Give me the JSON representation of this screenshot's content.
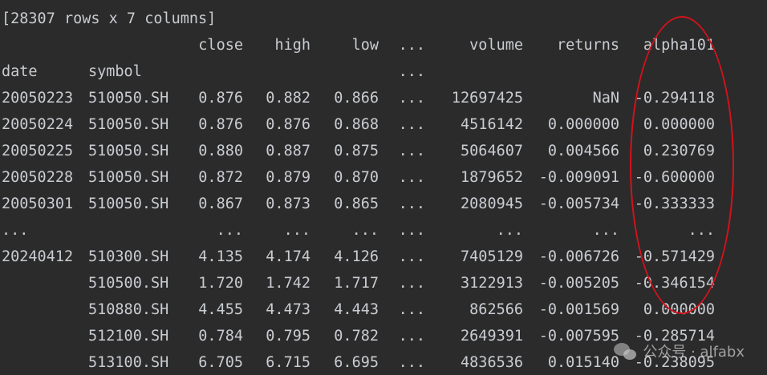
{
  "summary": "[28307 rows x 7 columns]",
  "header": {
    "close": "close",
    "high": "high",
    "low": "low",
    "ellipsis": "...",
    "volume": "volume",
    "returns": "returns",
    "alpha": "alpha101"
  },
  "index_header": {
    "date": "date",
    "symbol": "symbol",
    "ellipsis": "..."
  },
  "rows": [
    {
      "date": "20050223",
      "symbol": "510050.SH",
      "close": "0.876",
      "high": "0.882",
      "low": "0.866",
      "ellipsis": "...",
      "volume": "12697425",
      "returns": "NaN",
      "alpha": "-0.294118"
    },
    {
      "date": "20050224",
      "symbol": "510050.SH",
      "close": "0.876",
      "high": "0.876",
      "low": "0.868",
      "ellipsis": "...",
      "volume": "4516142",
      "returns": "0.000000",
      "alpha": "0.000000"
    },
    {
      "date": "20050225",
      "symbol": "510050.SH",
      "close": "0.880",
      "high": "0.887",
      "low": "0.875",
      "ellipsis": "...",
      "volume": "5064607",
      "returns": "0.004566",
      "alpha": "0.230769"
    },
    {
      "date": "20050228",
      "symbol": "510050.SH",
      "close": "0.872",
      "high": "0.879",
      "low": "0.870",
      "ellipsis": "...",
      "volume": "1879652",
      "returns": "-0.009091",
      "alpha": "-0.600000"
    },
    {
      "date": "20050301",
      "symbol": "510050.SH",
      "close": "0.867",
      "high": "0.873",
      "low": "0.865",
      "ellipsis": "...",
      "volume": "2080945",
      "returns": "-0.005734",
      "alpha": "-0.333333"
    },
    {
      "date": "...",
      "symbol": "",
      "close": "...",
      "high": "...",
      "low": "...",
      "ellipsis": "...",
      "volume": "...",
      "returns": "...",
      "alpha": "..."
    },
    {
      "date": "20240412",
      "symbol": "510300.SH",
      "close": "4.135",
      "high": "4.174",
      "low": "4.126",
      "ellipsis": "...",
      "volume": "7405129",
      "returns": "-0.006726",
      "alpha": "-0.571429"
    },
    {
      "date": "",
      "symbol": "510500.SH",
      "close": "1.720",
      "high": "1.742",
      "low": "1.717",
      "ellipsis": "...",
      "volume": "3122913",
      "returns": "-0.005205",
      "alpha": "-0.346154"
    },
    {
      "date": "",
      "symbol": "510880.SH",
      "close": "4.455",
      "high": "4.473",
      "low": "4.443",
      "ellipsis": "...",
      "volume": "862566",
      "returns": "-0.001569",
      "alpha": "0.000000"
    },
    {
      "date": "",
      "symbol": "512100.SH",
      "close": "0.784",
      "high": "0.795",
      "low": "0.782",
      "ellipsis": "...",
      "volume": "2649391",
      "returns": "-0.007595",
      "alpha": "-0.285714"
    },
    {
      "date": "",
      "symbol": "513100.SH",
      "close": "6.705",
      "high": "6.715",
      "low": "6.695",
      "ellipsis": "...",
      "volume": "4836536",
      "returns": "0.015140",
      "alpha": "-0.238095"
    }
  ],
  "watermark": {
    "text": "公众号 · alfabx",
    "icon": "wechat-icon"
  },
  "colors": {
    "background": "#2b2b2b",
    "text": "#c9ccd1",
    "highlight_ellipse": "#d3121c"
  }
}
